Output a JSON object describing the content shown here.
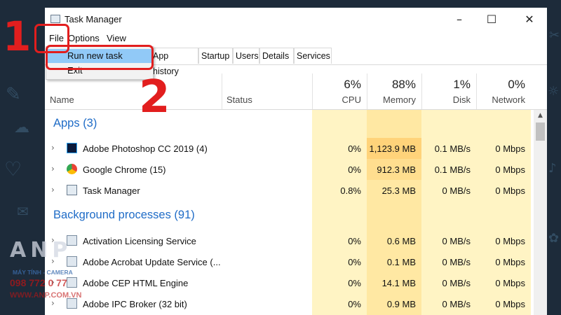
{
  "window": {
    "title": "Task Manager",
    "controls": [
      "–",
      "☐",
      "✕"
    ]
  },
  "menu": [
    "File",
    "Options",
    "View"
  ],
  "file_menu": {
    "run_new_task": "Run new task",
    "exit": "Exit"
  },
  "tabs": [
    "App history",
    "Startup",
    "Users",
    "Details",
    "Services"
  ],
  "columns": {
    "name": "Name",
    "status": "Status",
    "cpu": {
      "pct": "6%",
      "label": "CPU"
    },
    "memory": {
      "pct": "88%",
      "label": "Memory"
    },
    "disk": {
      "pct": "1%",
      "label": "Disk"
    },
    "network": {
      "pct": "0%",
      "label": "Network"
    }
  },
  "sections": {
    "apps": "Apps (3)",
    "background": "Background processes (91)"
  },
  "apps": [
    {
      "name": "Adobe Photoshop CC 2019 (4)",
      "icon": "photoshop-icon",
      "cpu": "0%",
      "memory": "1,123.9 MB",
      "disk": "0.1 MB/s",
      "network": "0 Mbps"
    },
    {
      "name": "Google Chrome (15)",
      "icon": "chrome-icon",
      "cpu": "0%",
      "memory": "912.3 MB",
      "disk": "0.1 MB/s",
      "network": "0 Mbps"
    },
    {
      "name": "Task Manager",
      "icon": "task-manager-icon",
      "cpu": "0.8%",
      "memory": "25.3 MB",
      "disk": "0 MB/s",
      "network": "0 Mbps"
    }
  ],
  "background": [
    {
      "name": "Activation Licensing Service",
      "cpu": "0%",
      "memory": "0.6 MB",
      "disk": "0 MB/s",
      "network": "0 Mbps"
    },
    {
      "name": "Adobe Acrobat Update Service (...",
      "cpu": "0%",
      "memory": "0.1 MB",
      "disk": "0 MB/s",
      "network": "0 Mbps"
    },
    {
      "name": "Adobe CEP HTML Engine",
      "cpu": "0%",
      "memory": "14.1 MB",
      "disk": "0 MB/s",
      "network": "0 Mbps"
    },
    {
      "name": "Adobe IPC Broker (32 bit)",
      "cpu": "0%",
      "memory": "0.9 MB",
      "disk": "0 MB/s",
      "network": "0 Mbps"
    }
  ],
  "annotations": {
    "step1": "1",
    "step2": "2"
  },
  "watermark": {
    "logo": "ANP",
    "tagline": "MÁY TÍNH - CAMERA",
    "phone": "098 772 0 77",
    "url": "WWW.ANP.COM.VN"
  },
  "colors": {
    "cpu_bg": "#fff4c4",
    "mem_bg": "#ffe8a3",
    "mem_hot": "#ffd37a",
    "mem_high": "#ffde8f",
    "section_text": "#1f6cc7",
    "highlight": "#91c9f7",
    "annotation": "#e21e1e"
  }
}
